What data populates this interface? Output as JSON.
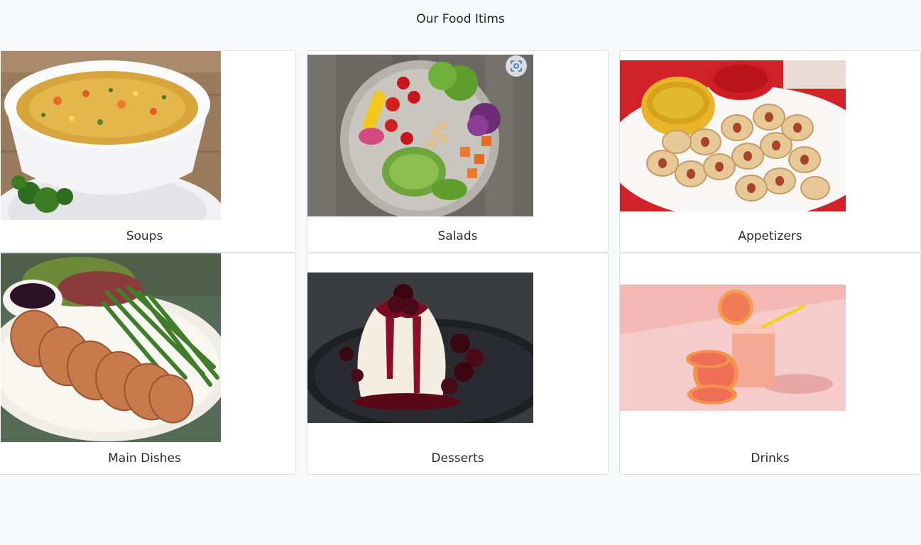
{
  "page": {
    "title": "Our Food Itims"
  },
  "cards": [
    {
      "label": "Soups"
    },
    {
      "label": "Salads"
    },
    {
      "label": "Appetizers"
    },
    {
      "label": "Main Dishes"
    },
    {
      "label": "Desserts"
    },
    {
      "label": "Drinks"
    }
  ],
  "icons": {
    "image_search": "lens-icon"
  }
}
